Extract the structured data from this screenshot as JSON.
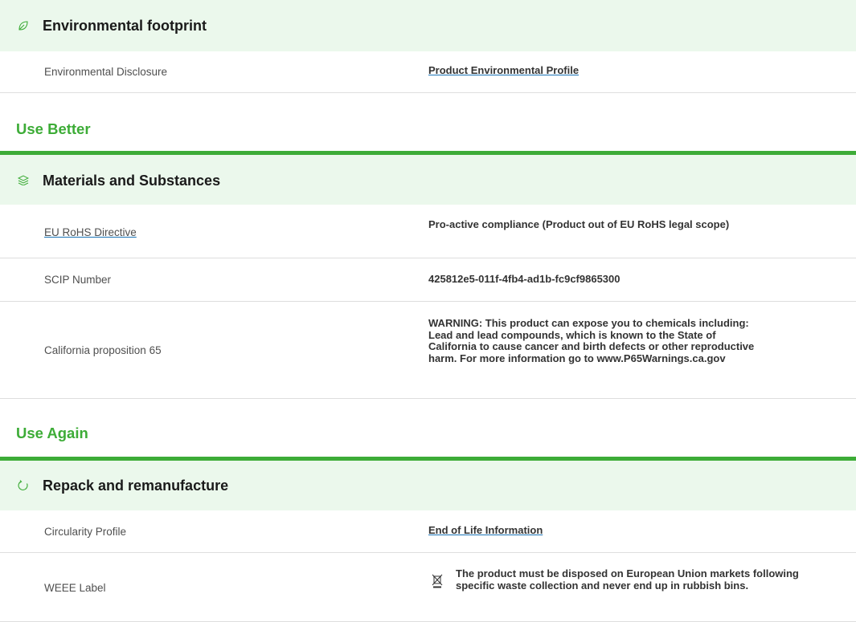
{
  "footprint": {
    "title": "Environmental footprint",
    "icon": "leaf-icon",
    "rows": [
      {
        "label": "Environmental Disclosure",
        "value": "Product Environmental Profile"
      }
    ]
  },
  "use_better": {
    "title": "Use Better",
    "section": {
      "title": "Materials and Substances",
      "icon": "layers-icon",
      "rows": [
        {
          "label": "EU RoHS Directive",
          "value": "Pro-active compliance (Product out of EU RoHS legal scope)"
        },
        {
          "label": "SCIP Number",
          "value": "425812e5-011f-4fb4-ad1b-fc9cf9865300"
        },
        {
          "label": "California proposition 65",
          "value": "WARNING: This product can expose you to chemicals including: Lead and lead compounds, which is known to the State of California to cause cancer and birth defects or other reproductive harm. For more information go to www.P65Warnings.ca.gov"
        }
      ]
    }
  },
  "use_again": {
    "title": "Use Again",
    "section": {
      "title": "Repack and remanufacture",
      "icon": "recycle-icon",
      "rows": [
        {
          "label": "Circularity Profile",
          "value": "End of Life Information"
        },
        {
          "label": "WEEE Label",
          "value": "The product must be disposed on European Union markets following specific waste collection and never end up in rubbish bins.",
          "icon": "crossed-bin-icon"
        }
      ]
    }
  },
  "colors": {
    "accent_green": "#3dac37",
    "header_bg": "#ebf8ec",
    "link_blue": "#1a73b5"
  }
}
